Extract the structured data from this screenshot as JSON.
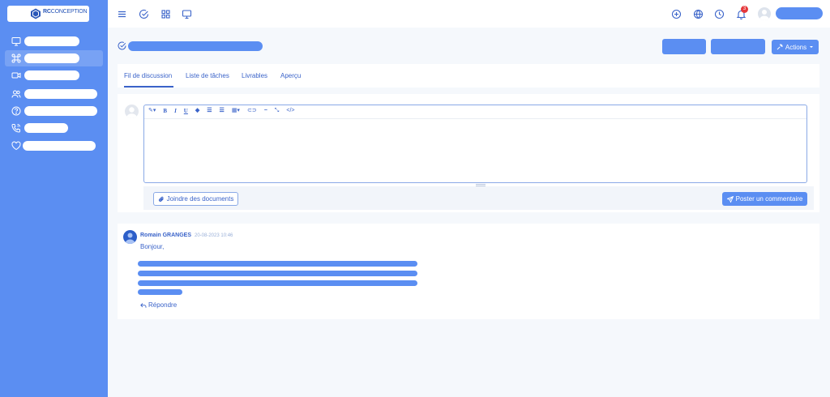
{
  "brand": {
    "name_bold": "RC",
    "name_rest": "CONCEPTION"
  },
  "sidebar": {
    "items": [
      {
        "icon": "monitor-icon",
        "active": false
      },
      {
        "icon": "command-icon",
        "active": true
      },
      {
        "icon": "video-icon",
        "active": false
      },
      {
        "icon": "users-icon",
        "active": false
      },
      {
        "icon": "help-circle-icon",
        "active": false
      },
      {
        "icon": "phone-icon",
        "active": false
      },
      {
        "icon": "heart-icon",
        "active": false
      }
    ]
  },
  "topbar": {
    "left_icons": [
      "menu-icon",
      "check-circle-icon",
      "grid-icon",
      "monitor-icon"
    ],
    "right_icons": [
      "plus-circle-icon",
      "globe-icon",
      "clock-icon",
      "bell-icon"
    ],
    "notification_count": "3"
  },
  "header": {
    "actions_label": "Actions"
  },
  "tabs": [
    {
      "label": "Fil de discussion",
      "active": true
    },
    {
      "label": "Liste de tâches",
      "active": false
    },
    {
      "label": "Livrables",
      "active": false
    },
    {
      "label": "Aperçu",
      "active": false
    }
  ],
  "editor": {
    "toolbar": [
      "magic-icon",
      "B",
      "I",
      "U",
      "eraser-icon",
      "list-ul-icon",
      "list-ol-icon",
      "table-icon",
      "link-icon",
      "hr-icon",
      "fullscreen-icon",
      "code-icon"
    ],
    "attach_label": "Joindre des documents",
    "post_label": "Poster un commentaire"
  },
  "comment": {
    "author": "Romain GRANGES",
    "date": "20-08-2023 10:46",
    "greeting": "Bonjour,",
    "reply_label": "Répondre"
  },
  "colors": {
    "primary": "#5b8ef2",
    "text": "#3a63c9",
    "badge": "#e5383b"
  }
}
